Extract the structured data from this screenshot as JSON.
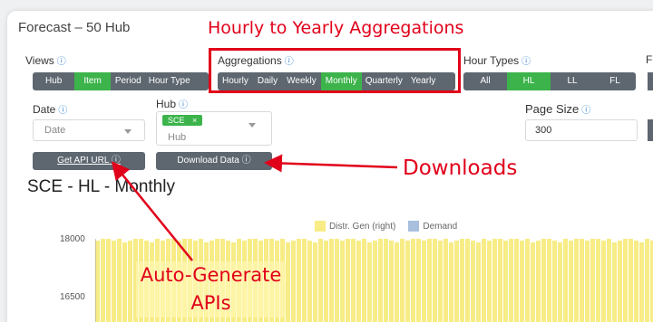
{
  "page": {
    "title": "Forecast – 50 Hub"
  },
  "views": {
    "label": "Views",
    "items": [
      "Hub",
      "Item",
      "Period",
      "Hour Type"
    ],
    "active": "Item"
  },
  "aggregations": {
    "label": "Aggregations",
    "items": [
      "Hourly",
      "Daily",
      "Weekly",
      "Monthly",
      "Quarterly",
      "Yearly"
    ],
    "active": "Monthly"
  },
  "hour_types": {
    "label": "Hour Types",
    "items": [
      "All",
      "HL",
      "LL",
      "FL"
    ],
    "active": "HL"
  },
  "cut_label": "F",
  "date": {
    "label": "Date",
    "placeholder": "Date"
  },
  "hub": {
    "label": "Hub",
    "tag": "SCE",
    "placeholder": "Hub"
  },
  "page_size": {
    "label": "Page Size",
    "value": "300"
  },
  "buttons": {
    "api": "Get API URL",
    "download": "Download Data"
  },
  "chart_heading": "SCE - HL - Monthly",
  "chart_data": {
    "type": "bar",
    "series": [
      {
        "name": "Distr. Gen (right)",
        "color": "#f7ec85"
      },
      {
        "name": "Demand",
        "color": "#a8c0dd"
      }
    ],
    "y_ticks": [
      "18000",
      "16500"
    ]
  },
  "annotations": {
    "aggregations": "Hourly to Yearly Aggregations",
    "downloads": "Downloads",
    "apis_line1": "Auto-Generate",
    "apis_line2": "APIs"
  },
  "colors": {
    "accent": "#3cb44b",
    "segment": "#5e6770",
    "annotation": "#e1001a",
    "info": "#2a7fd4"
  }
}
